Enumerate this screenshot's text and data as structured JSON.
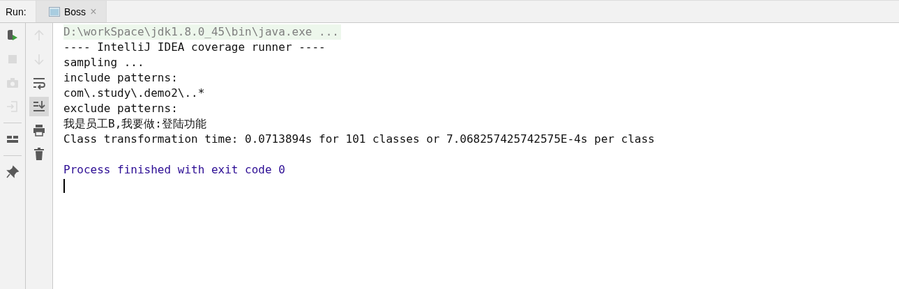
{
  "run_label": "Run:",
  "tabs": [
    {
      "label": "Boss",
      "selected": true,
      "closable": "×"
    }
  ],
  "toolbar_left": [
    {
      "kind": "rerun",
      "disabled": false
    },
    {
      "kind": "stop",
      "disabled": true
    },
    {
      "kind": "camera",
      "disabled": true
    },
    {
      "kind": "import",
      "disabled": true
    },
    {
      "kind": "layout",
      "disabled": false
    },
    {
      "kind": "pin",
      "disabled": false
    }
  ],
  "toolbar_right": [
    {
      "kind": "up",
      "disabled": true,
      "selected": false
    },
    {
      "kind": "down",
      "disabled": true,
      "selected": false
    },
    {
      "kind": "wrap",
      "disabled": false,
      "selected": false
    },
    {
      "kind": "scroll_end",
      "disabled": false,
      "selected": true
    },
    {
      "kind": "print",
      "disabled": false,
      "selected": false
    },
    {
      "kind": "trash",
      "disabled": false,
      "selected": false
    }
  ],
  "console_lines": [
    {
      "kind": "command",
      "text": "D:\\workSpace\\jdk1.8.0_45\\bin\\java.exe ..."
    },
    {
      "kind": "output",
      "text": "---- IntelliJ IDEA coverage runner ----"
    },
    {
      "kind": "output",
      "text": "sampling ..."
    },
    {
      "kind": "output",
      "text": "include patterns:"
    },
    {
      "kind": "output",
      "text": "com\\.study\\.demo2\\..*"
    },
    {
      "kind": "output",
      "text": "exclude patterns:"
    },
    {
      "kind": "output",
      "text": "我是员工B,我要做:登陆功能"
    },
    {
      "kind": "output",
      "text": "Class transformation time: 0.0713894s for 101 classes or 7.068257425742575E-4s per class"
    },
    {
      "kind": "blank"
    },
    {
      "kind": "system",
      "text": "Process finished with exit code 0"
    }
  ],
  "cursor": true
}
